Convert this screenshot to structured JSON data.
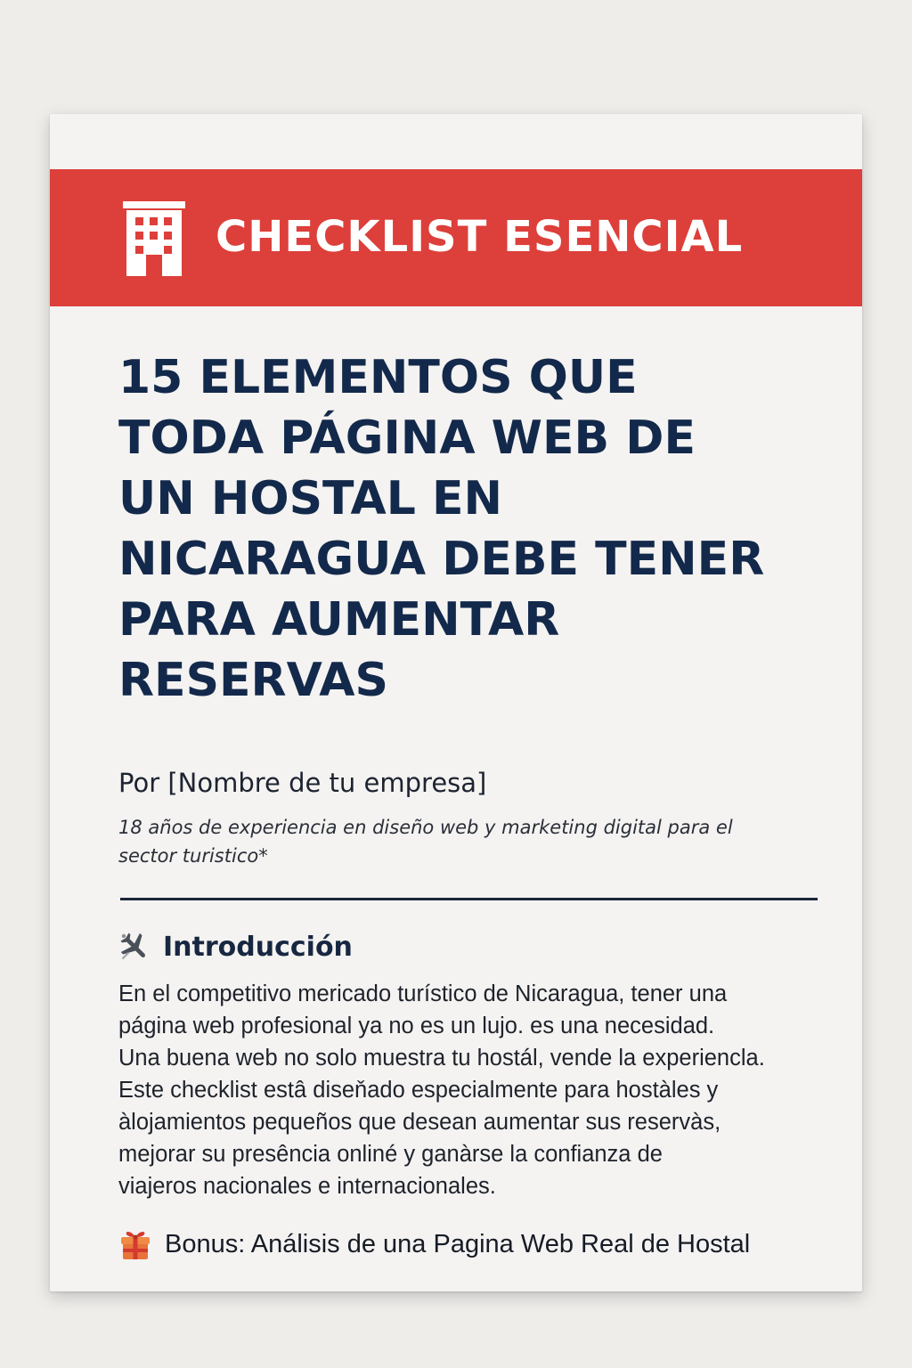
{
  "banner": {
    "icon": "hotel-building-icon",
    "title": "CHECKLIST ESENCIAL",
    "color": "#dd3f3a"
  },
  "main_title": {
    "lines": [
      "15 ELEMENTOS QUE",
      "TODA PÁGINA WEB DE",
      "UN HOSTAL EN",
      "NICARAGUA DEBE TENER",
      "PARA AUMENTAR",
      "RESERVAS"
    ],
    "color": "#13294b"
  },
  "author": "Por [Nombre de tu empresa]",
  "experience": "18 años de experiencia en diseño web y marketing digital para el sector turistico*",
  "intro": {
    "icon": "airplane-icon",
    "heading": "Introducción",
    "lines": [
      "En el competitivo mericado turístico de Nicaragua, tener una",
      "página web profesional ya no es un lujo. es una necesidad.",
      "Una buena web no solo muestra tu hostál, vende la experiencla.",
      "Este checklist estâ diseňado especialmente para hostàles y",
      "àlojamientos pequeños que desean aumentar sus reservàs,",
      "mejorar su presência onliné y ganàrse la confianza de",
      "viajeros nacionales e internacionales."
    ]
  },
  "bonus": {
    "icon": "gift-icon",
    "text": "Bonus: Análisis de una Pagina Web Real de Hostal"
  }
}
